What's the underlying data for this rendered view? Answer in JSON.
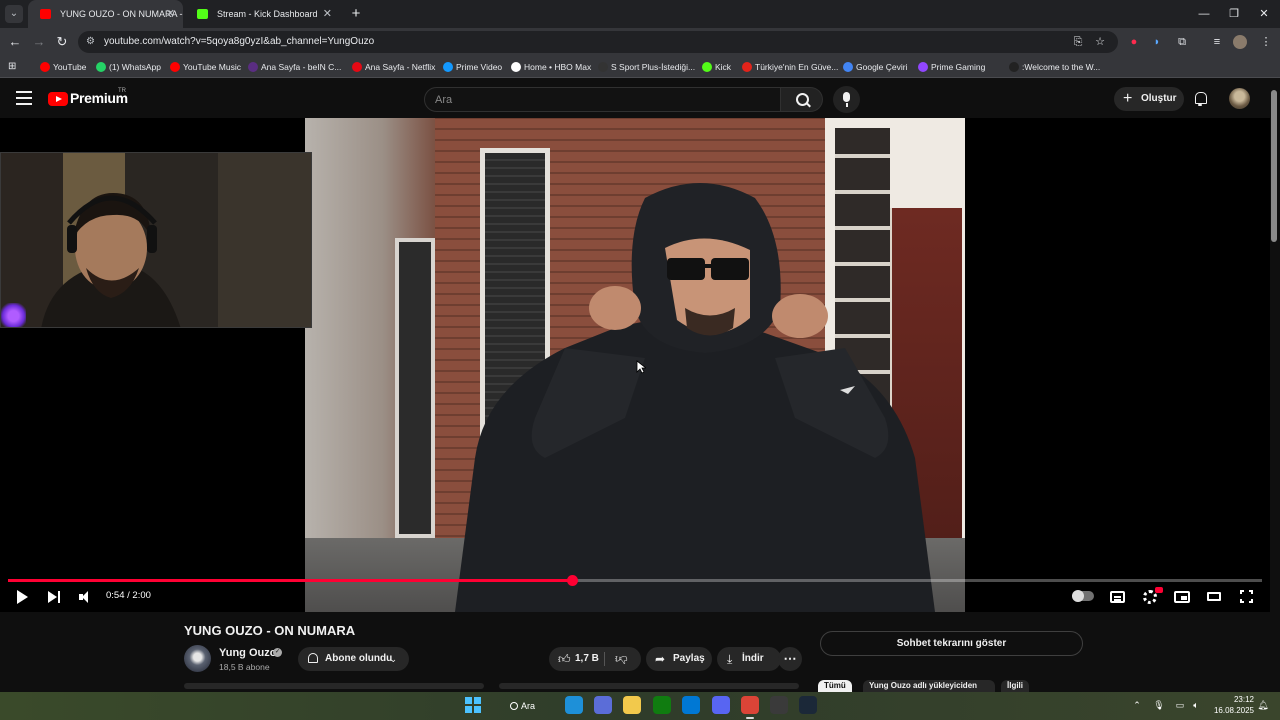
{
  "browser": {
    "tabs": [
      {
        "title": "YUNG OUZO - ON NUMARA - Y",
        "favicon_color": "#ff0000",
        "active": true
      },
      {
        "title": "Stream - Kick Dashboard",
        "favicon_color": "#53fc18",
        "active": false
      }
    ],
    "url": "youtube.com/watch?v=5qoya8g0yzI&ab_channel=YungOuzo",
    "bookmarks": [
      {
        "label": "YouTube",
        "color": "#ff0000"
      },
      {
        "label": "(1) WhatsApp",
        "color": "#25d366"
      },
      {
        "label": "YouTube Music",
        "color": "#ff0000"
      },
      {
        "label": "Ana Sayfa - beIN C...",
        "color": "#5a2d82"
      },
      {
        "label": "Ana Sayfa - Netflix",
        "color": "#e50914"
      },
      {
        "label": "Prime Video",
        "color": "#1399ff"
      },
      {
        "label": "Home • HBO Max",
        "color": "#ffffff"
      },
      {
        "label": "S Sport Plus-İstediği...",
        "color": "#333333"
      },
      {
        "label": "Kick",
        "color": "#53fc18"
      },
      {
        "label": "Türkiye'nin En Güve...",
        "color": "#e2231a"
      },
      {
        "label": "Google Çeviri",
        "color": "#4285f4"
      },
      {
        "label": "Prime Gaming",
        "color": "#9146ff"
      },
      {
        "label": ":Welcome to the W...",
        "color": "#222222"
      }
    ]
  },
  "youtube": {
    "brand": "Premium",
    "country": "TR",
    "search_placeholder": "Ara",
    "create_label": "Oluştur"
  },
  "player": {
    "current_time": "0:54",
    "duration": "2:00",
    "time_display": "0:54 / 2:00",
    "progress_fraction": 0.45,
    "accent": "#ff0033"
  },
  "video": {
    "title": "YUNG OUZO - ON NUMARA",
    "channel_name": "Yung Ouzo",
    "subscribers": "18,5 B abone",
    "subscribe_state": "Abone olundu",
    "likes": "1,7 B",
    "share_label": "Paylaş",
    "download_label": "İndir",
    "chat_button": "Sohbet tekrarını göster"
  },
  "recommend_chips": [
    "Tümü",
    "Yung Ouzo adlı yükleyiciden",
    "İlgili"
  ],
  "taskbar": {
    "search_label": "Ara",
    "apps": [
      {
        "name": "edge",
        "color": "#1e90d8"
      },
      {
        "name": "store",
        "color": "#5b6dd8"
      },
      {
        "name": "file-explorer",
        "color": "#f2c94c"
      },
      {
        "name": "xbox",
        "color": "#107c10"
      },
      {
        "name": "outlook",
        "color": "#0078d4"
      },
      {
        "name": "discord",
        "color": "#5865f2"
      },
      {
        "name": "chrome",
        "color": "#db4437"
      },
      {
        "name": "obs",
        "color": "#3a3a3a"
      },
      {
        "name": "steam",
        "color": "#1b2838"
      }
    ],
    "time": "23:12",
    "date": "16.08.2025"
  }
}
